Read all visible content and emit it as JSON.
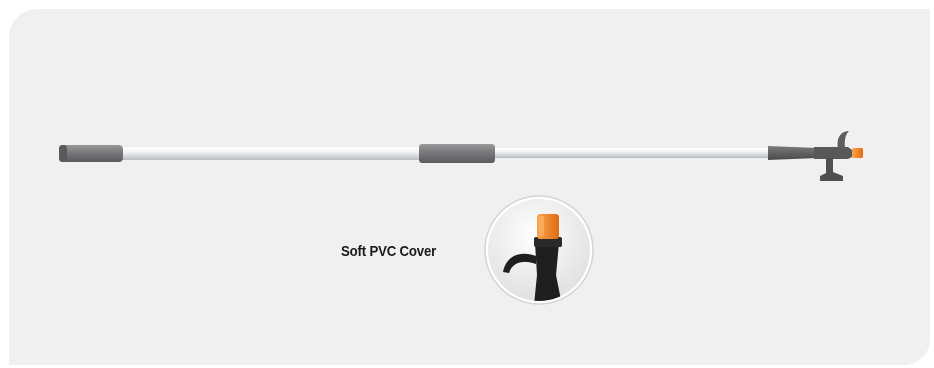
{
  "product": {
    "name": "boat-hook",
    "callout": {
      "label": "Soft PVC Cover"
    }
  },
  "colors": {
    "background_panel": "#f0f0f0",
    "shaft": "#e3e5e8",
    "grip": "#7a7a7c",
    "hook": "#5e5e60",
    "tip": "#f07d1b"
  }
}
